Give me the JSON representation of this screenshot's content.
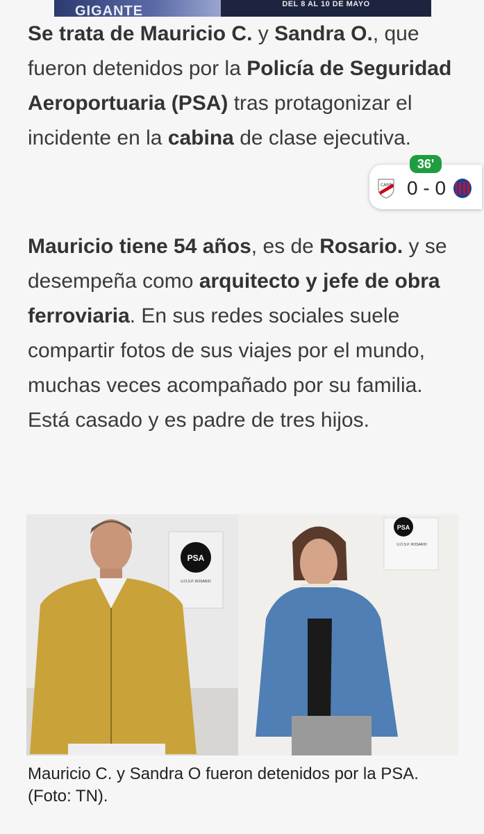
{
  "ad": {
    "left_text": "GIGANTE",
    "right_text": "DEL 8 AL 10 DE MAYO"
  },
  "article": {
    "p1": [
      {
        "t": "Se trata de ",
        "b": true
      },
      {
        "t": "Mauricio C.",
        "b": true
      },
      {
        "t": " y ",
        "b": false
      },
      {
        "t": "Sandra O.",
        "b": true
      },
      {
        "t": ", que fueron detenidos por la ",
        "b": false
      },
      {
        "t": "Policía de Seguridad Aeroportuaria (PSA)",
        "b": true
      },
      {
        "t": " tras protagonizar el incidente en la ",
        "b": false
      },
      {
        "t": "cabina",
        "b": true
      },
      {
        "t": " de clase ejecutiva.",
        "b": false
      }
    ],
    "p2": [
      {
        "t": "Mauricio tiene 54 años",
        "b": true
      },
      {
        "t": ", es de ",
        "b": false
      },
      {
        "t": "Rosario.",
        "b": true
      },
      {
        "t": " y se desempeña como ",
        "b": false
      },
      {
        "t": "arquitecto y jefe de obra ferroviaria",
        "b": true
      },
      {
        "t": ". En sus redes sociales suele compartir fotos de sus viajes por el mundo, muchas veces acompañado por su familia. Está casado y es padre de tres hijos.",
        "b": false
      }
    ]
  },
  "score_widget": {
    "minute": "36'",
    "result": "0 - 0",
    "home_badge": "river-plate-badge-icon",
    "away_badge": "san-lorenzo-badge-icon",
    "home_color": "#d0021b",
    "away_color": "#1c3f94"
  },
  "photo": {
    "left_poster_text": "PSA",
    "left_poster_subtext": "U.O.S.P. ROSARIO",
    "right_poster_text": "PSA",
    "right_poster_subtext": "U.O.S.P. ROSARIO"
  },
  "caption": "Mauricio C. y Sandra O fueron detenidos por la PSA. (Foto: TN)."
}
